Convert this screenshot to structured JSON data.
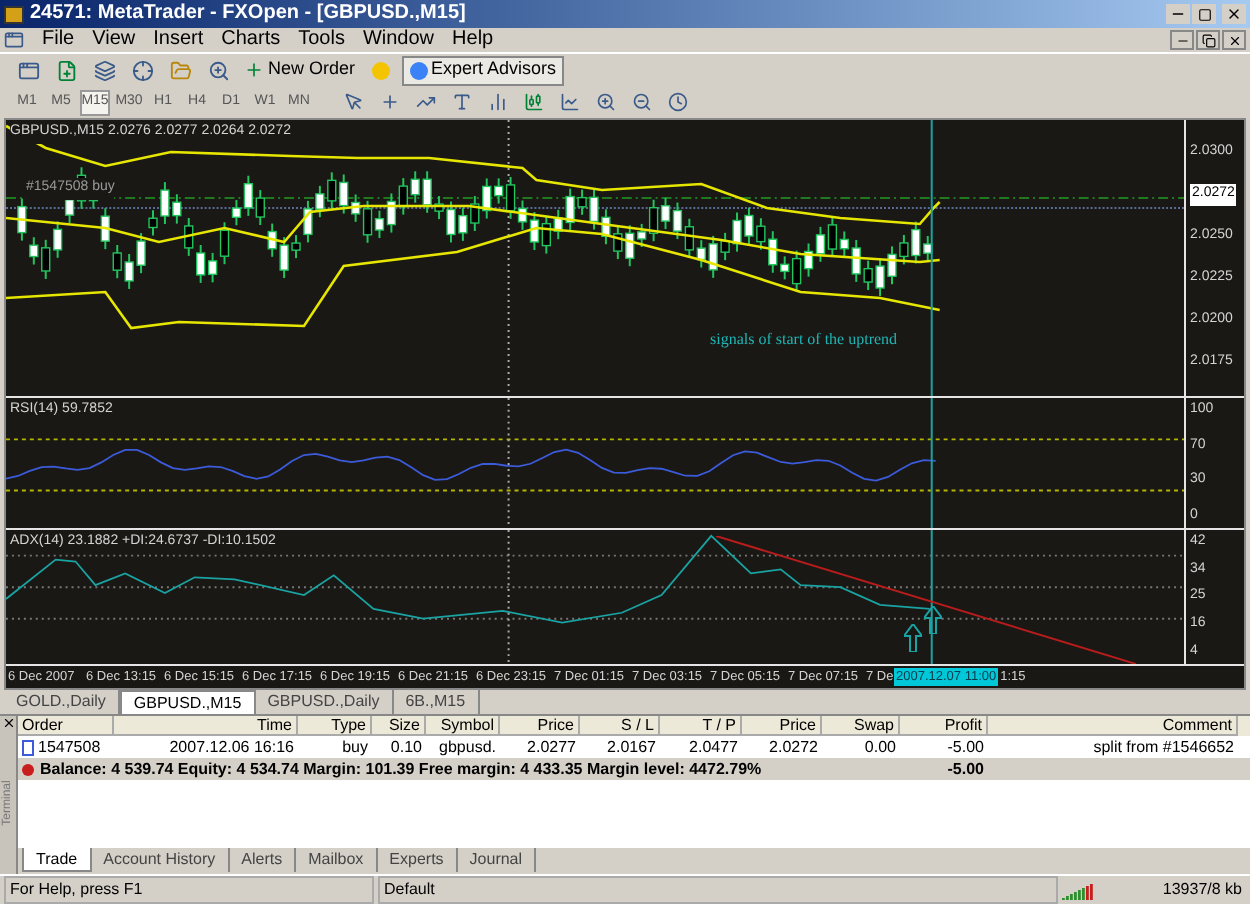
{
  "window": {
    "title": "24571: MetaTrader - FXOpen - [GBPUSD.,M15]"
  },
  "menu": [
    "File",
    "View",
    "Insert",
    "Charts",
    "Tools",
    "Window",
    "Help"
  ],
  "toolbar": {
    "new_order": "New Order",
    "expert_advisors": {
      "label": "Expert Advisors",
      "pressed": true
    }
  },
  "timeframes": [
    {
      "label": "M1",
      "selected": false
    },
    {
      "label": "M5",
      "selected": false
    },
    {
      "label": "M15",
      "selected": true
    },
    {
      "label": "M30",
      "selected": false
    },
    {
      "label": "H1",
      "selected": false
    },
    {
      "label": "H4",
      "selected": false
    },
    {
      "label": "D1",
      "selected": false
    },
    {
      "label": "W1",
      "selected": false
    },
    {
      "label": "MN",
      "selected": false
    }
  ],
  "chart": {
    "title": "GBPUSD.,M15  2.0276 2.0277 2.0264 2.0272",
    "order_label": "#1547508 buy",
    "annotation": "signals of start of the uptrend",
    "price_axis": [
      {
        "text": "2.0300",
        "kind": "tick"
      },
      {
        "text": "2.0272",
        "kind": "current"
      },
      {
        "text": "2.0250",
        "kind": "tick"
      },
      {
        "text": "2.0225",
        "kind": "tick"
      },
      {
        "text": "2.0200",
        "kind": "tick"
      },
      {
        "text": "2.0175",
        "kind": "tick"
      }
    ]
  },
  "rsi": {
    "title": "RSI(14) 59.7852",
    "axis": [
      "100",
      "70",
      "30",
      "0"
    ]
  },
  "adx": {
    "title": "ADX(14) 23.1882  +DI:24.6737  -DI:10.1502",
    "axis": [
      "42",
      "34",
      "25",
      "16",
      "4"
    ]
  },
  "time_axis": [
    {
      "text": "6 Dec 2007",
      "kind": "tick"
    },
    {
      "text": "6 Dec 13:15",
      "kind": "tick"
    },
    {
      "text": "6 Dec 15:15",
      "kind": "tick"
    },
    {
      "text": "6 Dec 17:15",
      "kind": "tick"
    },
    {
      "text": "6 Dec 19:15",
      "kind": "tick"
    },
    {
      "text": "6 Dec 21:15",
      "kind": "tick"
    },
    {
      "text": "6 Dec 23:15",
      "kind": "tick"
    },
    {
      "text": "7 Dec 01:15",
      "kind": "tick"
    },
    {
      "text": "7 Dec 03:15",
      "kind": "tick"
    },
    {
      "text": "7 Dec 05:15",
      "kind": "tick"
    },
    {
      "text": "7 Dec 07:15",
      "kind": "tick"
    },
    {
      "text": "7 De",
      "kind": "tick"
    },
    {
      "text": "2007.12.07 11:00",
      "kind": "cursor"
    },
    {
      "text": "1:15",
      "kind": "tick"
    }
  ],
  "chart_tabs": [
    {
      "label": "GOLD.,Daily",
      "selected": false
    },
    {
      "label": "GBPUSD.,M15",
      "selected": true
    },
    {
      "label": "GBPUSD.,Daily",
      "selected": false
    },
    {
      "label": "6B.,M15",
      "selected": false
    }
  ],
  "terminal": {
    "side_label": "Terminal",
    "columns": [
      "Order",
      "Time",
      "Type",
      "Size",
      "Symbol",
      "Price",
      "S / L",
      "T / P",
      "Price",
      "Swap",
      "Profit",
      "Comment"
    ],
    "rows": [
      {
        "cells": [
          "1547508",
          "2007.12.06 16:16",
          "buy",
          "0.10",
          "gbpusd.",
          "2.0277",
          "2.0167",
          "2.0477",
          "2.0272",
          "0.00",
          "-5.00",
          "split from #1546652"
        ]
      }
    ],
    "summary": {
      "text": "Balance: 4 539.74  Equity: 4 534.74  Margin: 101.39  Free margin: 4 433.35  Margin level: 4472.79%",
      "profit": "-5.00"
    },
    "tabs": [
      {
        "label": "Trade",
        "selected": true
      },
      {
        "label": "Account History",
        "selected": false
      },
      {
        "label": "Alerts",
        "selected": false
      },
      {
        "label": "Mailbox",
        "selected": false
      },
      {
        "label": "Experts",
        "selected": false
      },
      {
        "label": "Journal",
        "selected": false
      }
    ]
  },
  "status_bar": [
    "For Help, press F1",
    "Default",
    "13937/8 kb"
  ]
}
